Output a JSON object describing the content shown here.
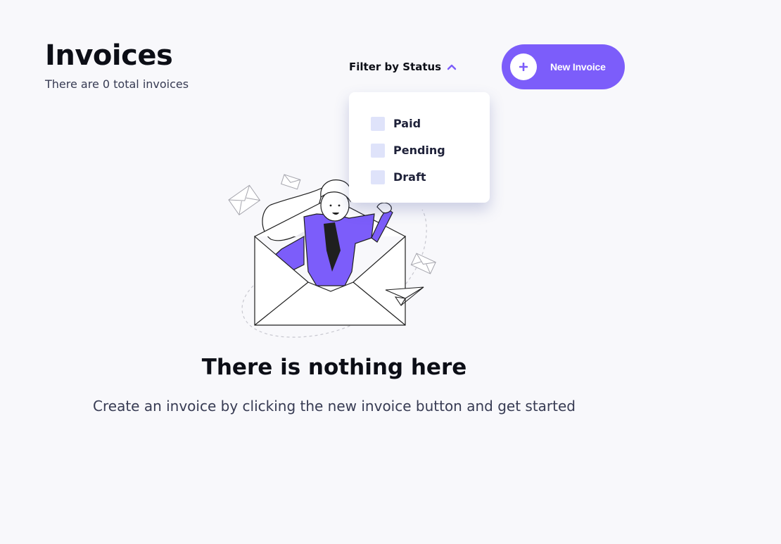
{
  "header": {
    "title": "Invoices",
    "subtitle": "There are 0 total invoices"
  },
  "filter": {
    "label": "Filter by Status",
    "expanded": true,
    "options": [
      {
        "label": "Paid",
        "checked": false
      },
      {
        "label": "Pending",
        "checked": false
      },
      {
        "label": "Draft",
        "checked": false
      }
    ]
  },
  "new_invoice": {
    "label": "New Invoice",
    "icon": "plus-icon"
  },
  "empty_state": {
    "title": "There is nothing here",
    "text": "Create an invoice by clicking the new invoice button and get started",
    "illustration": "woman-in-envelope-illustration"
  },
  "colors": {
    "accent": "#7c5dfa",
    "background": "#f8f8fb",
    "checkbox": "#dfe3fa",
    "text_dark": "#0c0e16",
    "text_muted": "#373b53"
  }
}
